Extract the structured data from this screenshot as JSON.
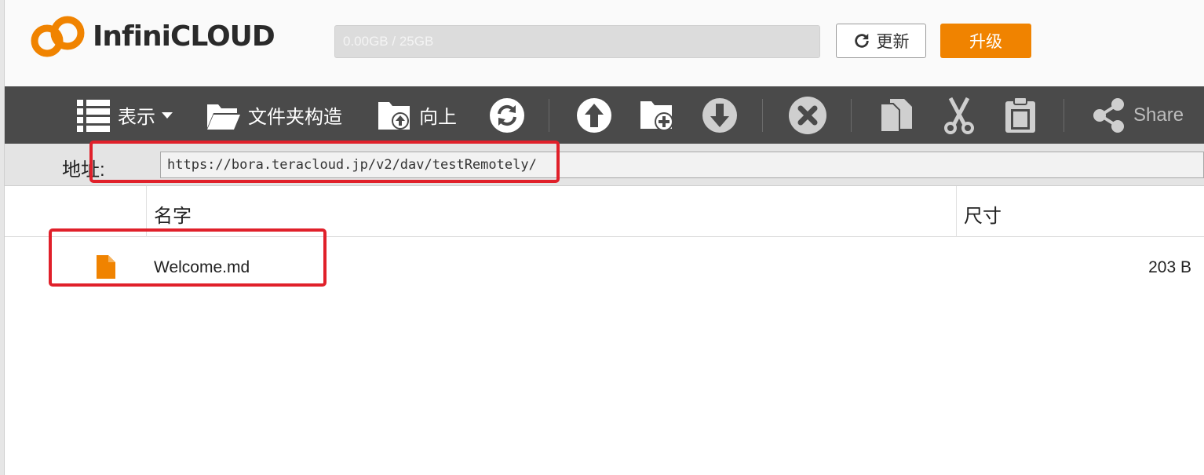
{
  "header": {
    "logo_text": "InfiniCLOUD",
    "usage_text": "0.00GB / 25GB",
    "usage_fraction": 0.0,
    "refresh_label": "更新",
    "upgrade_label": "升级"
  },
  "toolbar": {
    "view_label": "表示",
    "folder_structure_label": "文件夹构造",
    "up_label": "向上",
    "share_label": "Share"
  },
  "address": {
    "label": "地址:",
    "value": "https://bora.teracloud.jp/v2/dav/testRemotely/"
  },
  "table": {
    "columns": [
      "名字",
      "尺寸"
    ],
    "rows": [
      {
        "icon": "file-icon",
        "name": "Welcome.md",
        "size": "203 B"
      }
    ]
  },
  "colors": {
    "accent": "#f08300",
    "toolbar_bg": "#4a4a4a",
    "highlight": "#e0202a"
  }
}
